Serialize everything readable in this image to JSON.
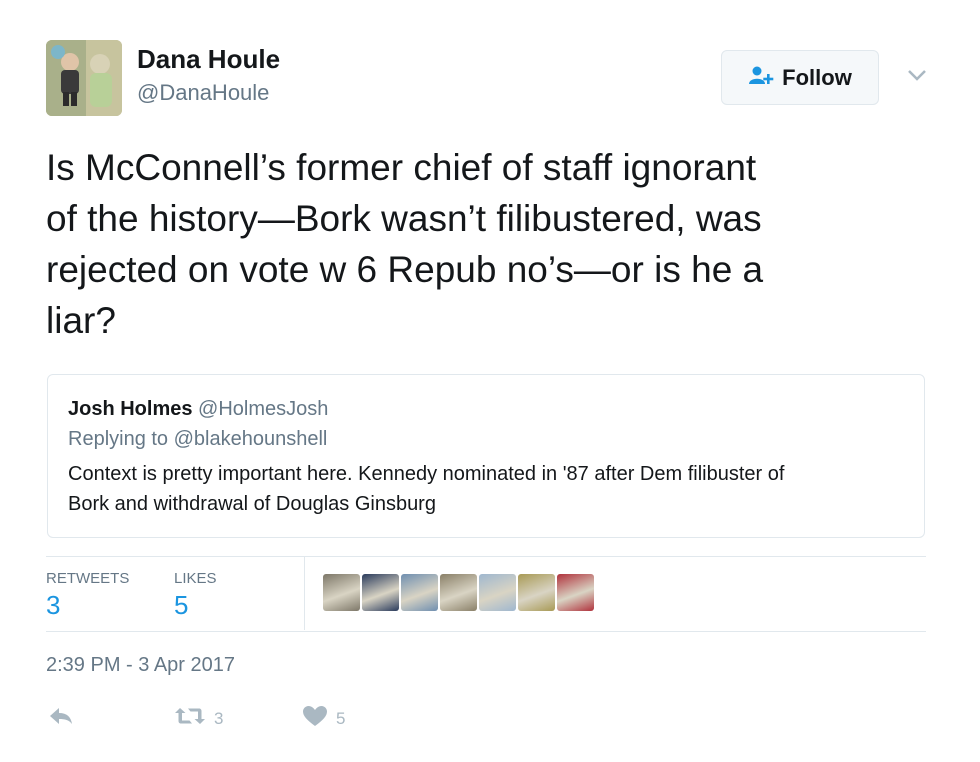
{
  "author": {
    "name": "Dana Houle",
    "handle": "@DanaHoule"
  },
  "follow_button": {
    "label": "Follow"
  },
  "tweet": {
    "lines": [
      "Is McConnell’s former chief of staff ignorant",
      "of the history—Bork wasn’t filibustered, was",
      "rejected on vote w 6 Repub no’s—or is he a",
      "liar?"
    ]
  },
  "quoted_tweet": {
    "name": "Josh Holmes",
    "handle": "@HolmesJosh",
    "reply_context": "Replying to @blakehounshell",
    "text_lines": [
      "Context is pretty important here.  Kennedy nominated in '87 after Dem filibuster of",
      "Bork and withdrawal of Douglas Ginsburg"
    ]
  },
  "stats": {
    "retweets": {
      "label": "RETWEETS",
      "value": "3"
    },
    "likes": {
      "label": "LIKES",
      "value": "5"
    }
  },
  "liker_avatar_colors": [
    "#7d7768",
    "#2a3b5c",
    "#6f8fb0",
    "#8a8068",
    "#9fb7cf",
    "#a89a55",
    "#b0323c"
  ],
  "timestamp": "2:39 PM - 3 Apr 2017",
  "actions": {
    "retweet_count": "3",
    "like_count": "5"
  },
  "colors": {
    "accent": "#1b95e0",
    "muted": "#657786",
    "icon_gray": "#aab8c2",
    "border": "#e1e8ed"
  },
  "icons": [
    "user-plus-icon",
    "chevron-down-icon",
    "reply-icon",
    "retweet-icon",
    "heart-icon"
  ]
}
